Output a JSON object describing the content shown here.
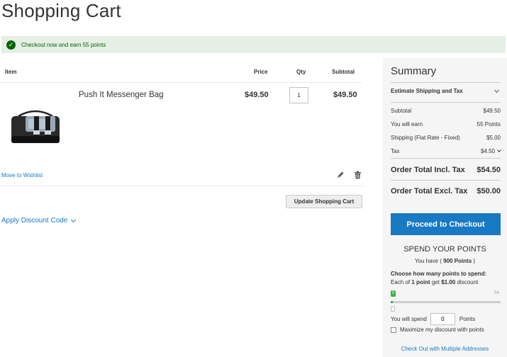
{
  "page": {
    "title": "Shopping Cart"
  },
  "notice": {
    "text": "Checkout now and earn 55 points"
  },
  "cart": {
    "headers": {
      "item": "Item",
      "price": "Price",
      "qty": "Qty",
      "subtotal": "Subtotal"
    },
    "item": {
      "name": "Push It Messenger Bag",
      "price": "$49.50",
      "qty": "1",
      "subtotal": "$49.50"
    },
    "move_to_wishlist": "Move to Wishlist",
    "update_label": "Update Shopping Cart",
    "discount_label": "Apply Discount Code"
  },
  "summary": {
    "title": "Summary",
    "estimate_label": "Estimate Shipping and Tax",
    "rows": {
      "subtotal": {
        "label": "Subtotal",
        "value": "$49.50"
      },
      "earn": {
        "label": "You will earn",
        "value": "55 Points"
      },
      "shipping": {
        "label": "Shipping (Flat Rate - Fixed)",
        "value": "$5.00"
      },
      "tax": {
        "label": "Tax",
        "value": "$4.50"
      },
      "total_incl": {
        "label": "Order Total Incl. Tax",
        "value": "$54.50"
      },
      "total_excl": {
        "label": "Order Total Excl. Tax",
        "value": "$50.00"
      }
    },
    "checkout_label": "Proceed to Checkout",
    "points": {
      "title": "SPEND YOUR POINTS",
      "you_have_prefix": "You have (",
      "you_have_value": "900 Points",
      "you_have_suffix": ")",
      "choose_label": "Choose how many points to spend:",
      "each_prefix": "Each of",
      "each_points": "1 point",
      "each_middle": "get",
      "each_amount": "$1.00",
      "each_suffix": "discount",
      "slider_min": "0",
      "slider_max": "54",
      "slider_value": 0,
      "spend_prefix": "You will spend",
      "spend_value": "0",
      "spend_suffix": "Points",
      "maximize_label": "Maximize my discount with points"
    },
    "multi_address_label": "Check Out with Multiple Addresses"
  },
  "colors": {
    "accent": "#1979c3",
    "success": "#006400",
    "slider": "#3db13d"
  }
}
